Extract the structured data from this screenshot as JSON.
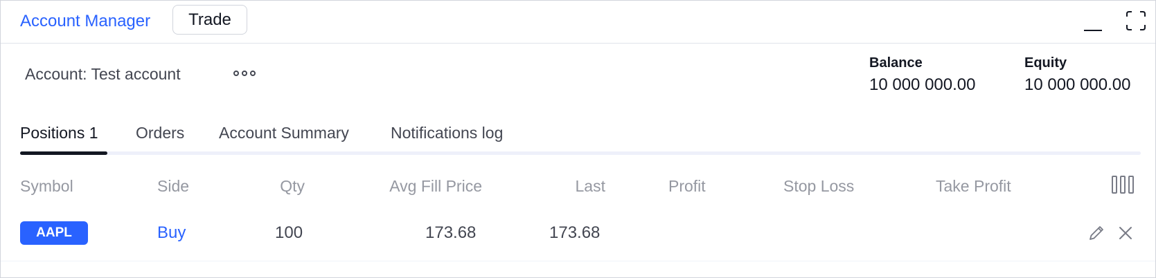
{
  "header": {
    "account_manager_label": "Account Manager",
    "trade_label": "Trade"
  },
  "account": {
    "label": "Account: Test account",
    "balance_label": "Balance",
    "balance_value": "10 000 000.00",
    "equity_label": "Equity",
    "equity_value": "10 000 000.00"
  },
  "tabs": [
    {
      "label": "Positions 1",
      "active": true
    },
    {
      "label": "Orders",
      "active": false
    },
    {
      "label": "Account Summary",
      "active": false
    },
    {
      "label": "Notifications log",
      "active": false
    }
  ],
  "table": {
    "columns": [
      "Symbol",
      "Side",
      "Qty",
      "Avg Fill Price",
      "Last",
      "Profit",
      "Stop Loss",
      "Take Profit"
    ],
    "rows": [
      {
        "symbol": "AAPL",
        "side": "Buy",
        "qty": "100",
        "avg_fill_price": "173.68",
        "last": "173.68",
        "profit": "",
        "stop_loss": "",
        "take_profit": ""
      }
    ]
  },
  "colors": {
    "accent": "#2962ff",
    "text": "#131722",
    "muted": "#9598a1"
  },
  "icons": [
    "more-horizontal-icon",
    "minimize-icon",
    "maximize-icon",
    "column-settings-icon",
    "pencil-icon",
    "close-icon"
  ]
}
